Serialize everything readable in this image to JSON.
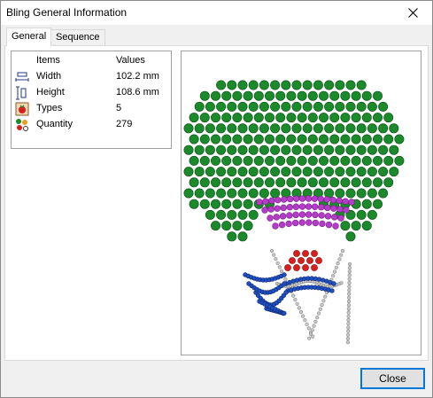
{
  "window": {
    "title": "Bling General Information",
    "close_icon": "close-icon"
  },
  "tabs": [
    {
      "label": "General",
      "active": true
    },
    {
      "label": "Sequence",
      "active": false
    }
  ],
  "info_table": {
    "headers": {
      "items": "Items",
      "values": "Values"
    },
    "rows": [
      {
        "icon": "width-icon",
        "item": "Width",
        "value": "102.2 mm"
      },
      {
        "icon": "height-icon",
        "item": "Height",
        "value": "108.6 mm"
      },
      {
        "icon": "types-icon",
        "item": "Types",
        "value": "5"
      },
      {
        "icon": "quantity-icon",
        "item": "Quantity",
        "value": "279"
      }
    ]
  },
  "preview": {
    "design": "bling rhinestone design",
    "colors": {
      "green": "#1b8a2a",
      "purple": "#b43cc8",
      "red": "#d81e1e",
      "silver": "#c8c8c8",
      "blue": "#1e4fc2"
    }
  },
  "buttons": {
    "close_label": "Close"
  },
  "colors": {
    "accent": "#0078d7"
  }
}
